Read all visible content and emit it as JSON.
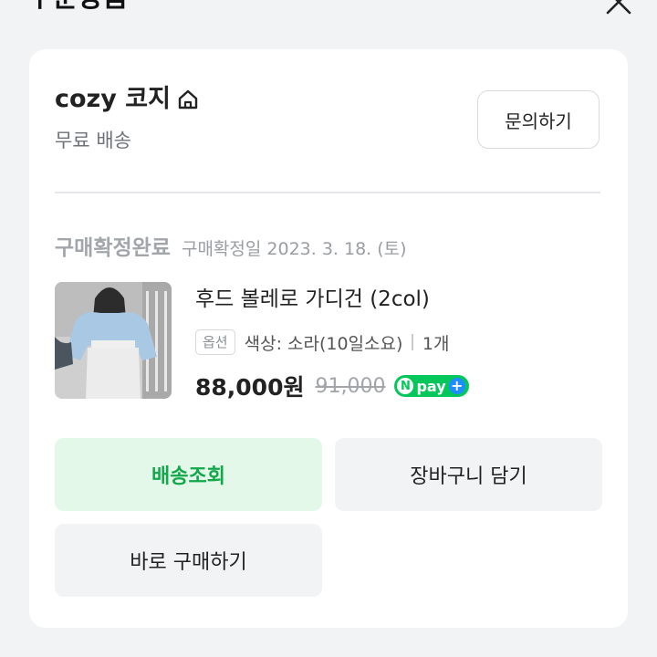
{
  "header": {
    "title": "주문상품"
  },
  "store": {
    "name": "cozy 코지",
    "shipping": "무료 배송",
    "inquiry_label": "문의하기"
  },
  "order": {
    "status": "구매확정완료",
    "confirmed_date": "구매확정일 2023. 3. 18. (토)"
  },
  "product": {
    "name": "후드 볼레로 가디건 (2col)",
    "option_badge": "옵션",
    "option_text": "색상: 소라(10일소요)",
    "quantity": "1개",
    "price": "88,000원",
    "original_price": "91,000",
    "npay_n": "N",
    "npay_label": "pay",
    "npay_plus": "+"
  },
  "actions": {
    "track": "배송조회",
    "cart": "장바구니 담기",
    "buy_now": "바로 구매하기"
  },
  "colors": {
    "accent_green": "#03c75a",
    "track_text": "#12a84a",
    "track_bg": "#e3f8e9",
    "npay_plus": "#1e8dff"
  }
}
